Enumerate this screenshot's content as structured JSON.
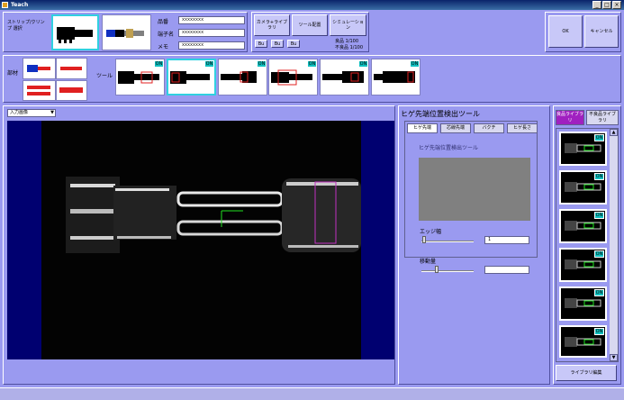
{
  "window": {
    "title": "Teach",
    "min_icon": "minimize-icon",
    "max_icon": "maximize-icon",
    "close_icon": "close-icon",
    "min_glyph": "_",
    "max_glyph": "□",
    "close_glyph": "×"
  },
  "top": {
    "strip_label": "ストリップ/クリンプ 選択",
    "hinban_label": "品番",
    "hinban_value": "xxxxxxxx",
    "tanshi_label": "端子名",
    "tanshi_value": "xxxxxxxx",
    "memo_label": "メモ",
    "memo_value": "xxxxxxxx",
    "camera_button": "カメラ+ライブラリ",
    "tool_button": "ツール配置",
    "sim_button": "シミュレーション",
    "small_buttons": [
      "Bu",
      "Bu",
      "Bu"
    ],
    "good_count": "良品 1/100",
    "bad_count": "不良品 1/100",
    "ok_button": "OK",
    "cancel_button": "キャンセル"
  },
  "second": {
    "material_label": "部材",
    "tool_label": "ツール",
    "on_badge": "ON"
  },
  "image_panel": {
    "input_select": "入力画像"
  },
  "tool_panel": {
    "title": "ヒゲ先端位置検出ツール",
    "tabs": [
      "ヒゲ先端",
      "芯線先端",
      "バクチ",
      "ヒゲ長さ"
    ],
    "subtitle": "ヒゲ先端位置検出ツール",
    "edge_label": "エッジ幅",
    "edge_value": "1",
    "move_label": "移動量",
    "move_value": ""
  },
  "library": {
    "tabs": [
      "良品ライブラリ",
      "不良品ライブラリ"
    ],
    "on_badge": "ON",
    "edit_button": "ライブラリ編集"
  },
  "colors": {
    "panel": "#9a9af0",
    "accent_cyan": "#30d0e0",
    "badge": "#10c0c0",
    "image_bg": "#000070"
  }
}
